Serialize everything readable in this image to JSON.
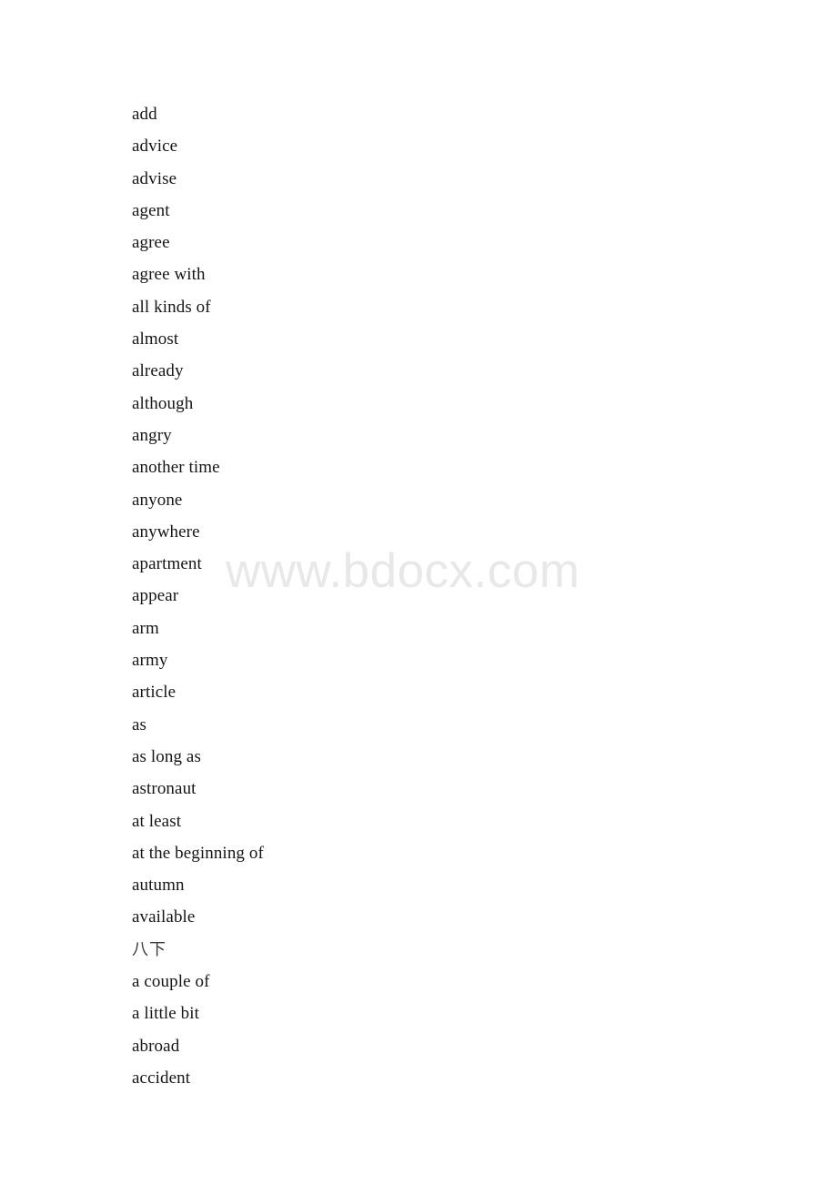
{
  "document": {
    "watermark": "www.bdocx.com",
    "background_color": "#ffffff",
    "text_color": "#151515",
    "watermark_color": "#e7e8e8"
  },
  "word_list": {
    "entries": [
      {
        "text": "add",
        "script": "latin"
      },
      {
        "text": "advice",
        "script": "latin"
      },
      {
        "text": "advise",
        "script": "latin"
      },
      {
        "text": "agent",
        "script": "latin"
      },
      {
        "text": "agree",
        "script": "latin"
      },
      {
        "text": "agree with",
        "script": "latin"
      },
      {
        "text": "all kinds of",
        "script": "latin"
      },
      {
        "text": "almost",
        "script": "latin"
      },
      {
        "text": "already",
        "script": "latin"
      },
      {
        "text": "although",
        "script": "latin"
      },
      {
        "text": "angry",
        "script": "latin"
      },
      {
        "text": "another time",
        "script": "latin"
      },
      {
        "text": "anyone",
        "script": "latin"
      },
      {
        "text": "anywhere",
        "script": "latin"
      },
      {
        "text": "apartment",
        "script": "latin"
      },
      {
        "text": "appear",
        "script": "latin"
      },
      {
        "text": "arm",
        "script": "latin"
      },
      {
        "text": "army",
        "script": "latin"
      },
      {
        "text": "article",
        "script": "latin"
      },
      {
        "text": "as",
        "script": "latin"
      },
      {
        "text": "as long as",
        "script": "latin"
      },
      {
        "text": "astronaut",
        "script": "latin"
      },
      {
        "text": "at least",
        "script": "latin"
      },
      {
        "text": "at the beginning of",
        "script": "latin"
      },
      {
        "text": "autumn",
        "script": "latin"
      },
      {
        "text": "available",
        "script": "latin"
      },
      {
        "text": "八下",
        "script": "cjk"
      },
      {
        "text": "a couple of",
        "script": "latin"
      },
      {
        "text": "a little bit",
        "script": "latin"
      },
      {
        "text": "abroad",
        "script": "latin"
      },
      {
        "text": "accident",
        "script": "latin"
      }
    ]
  }
}
